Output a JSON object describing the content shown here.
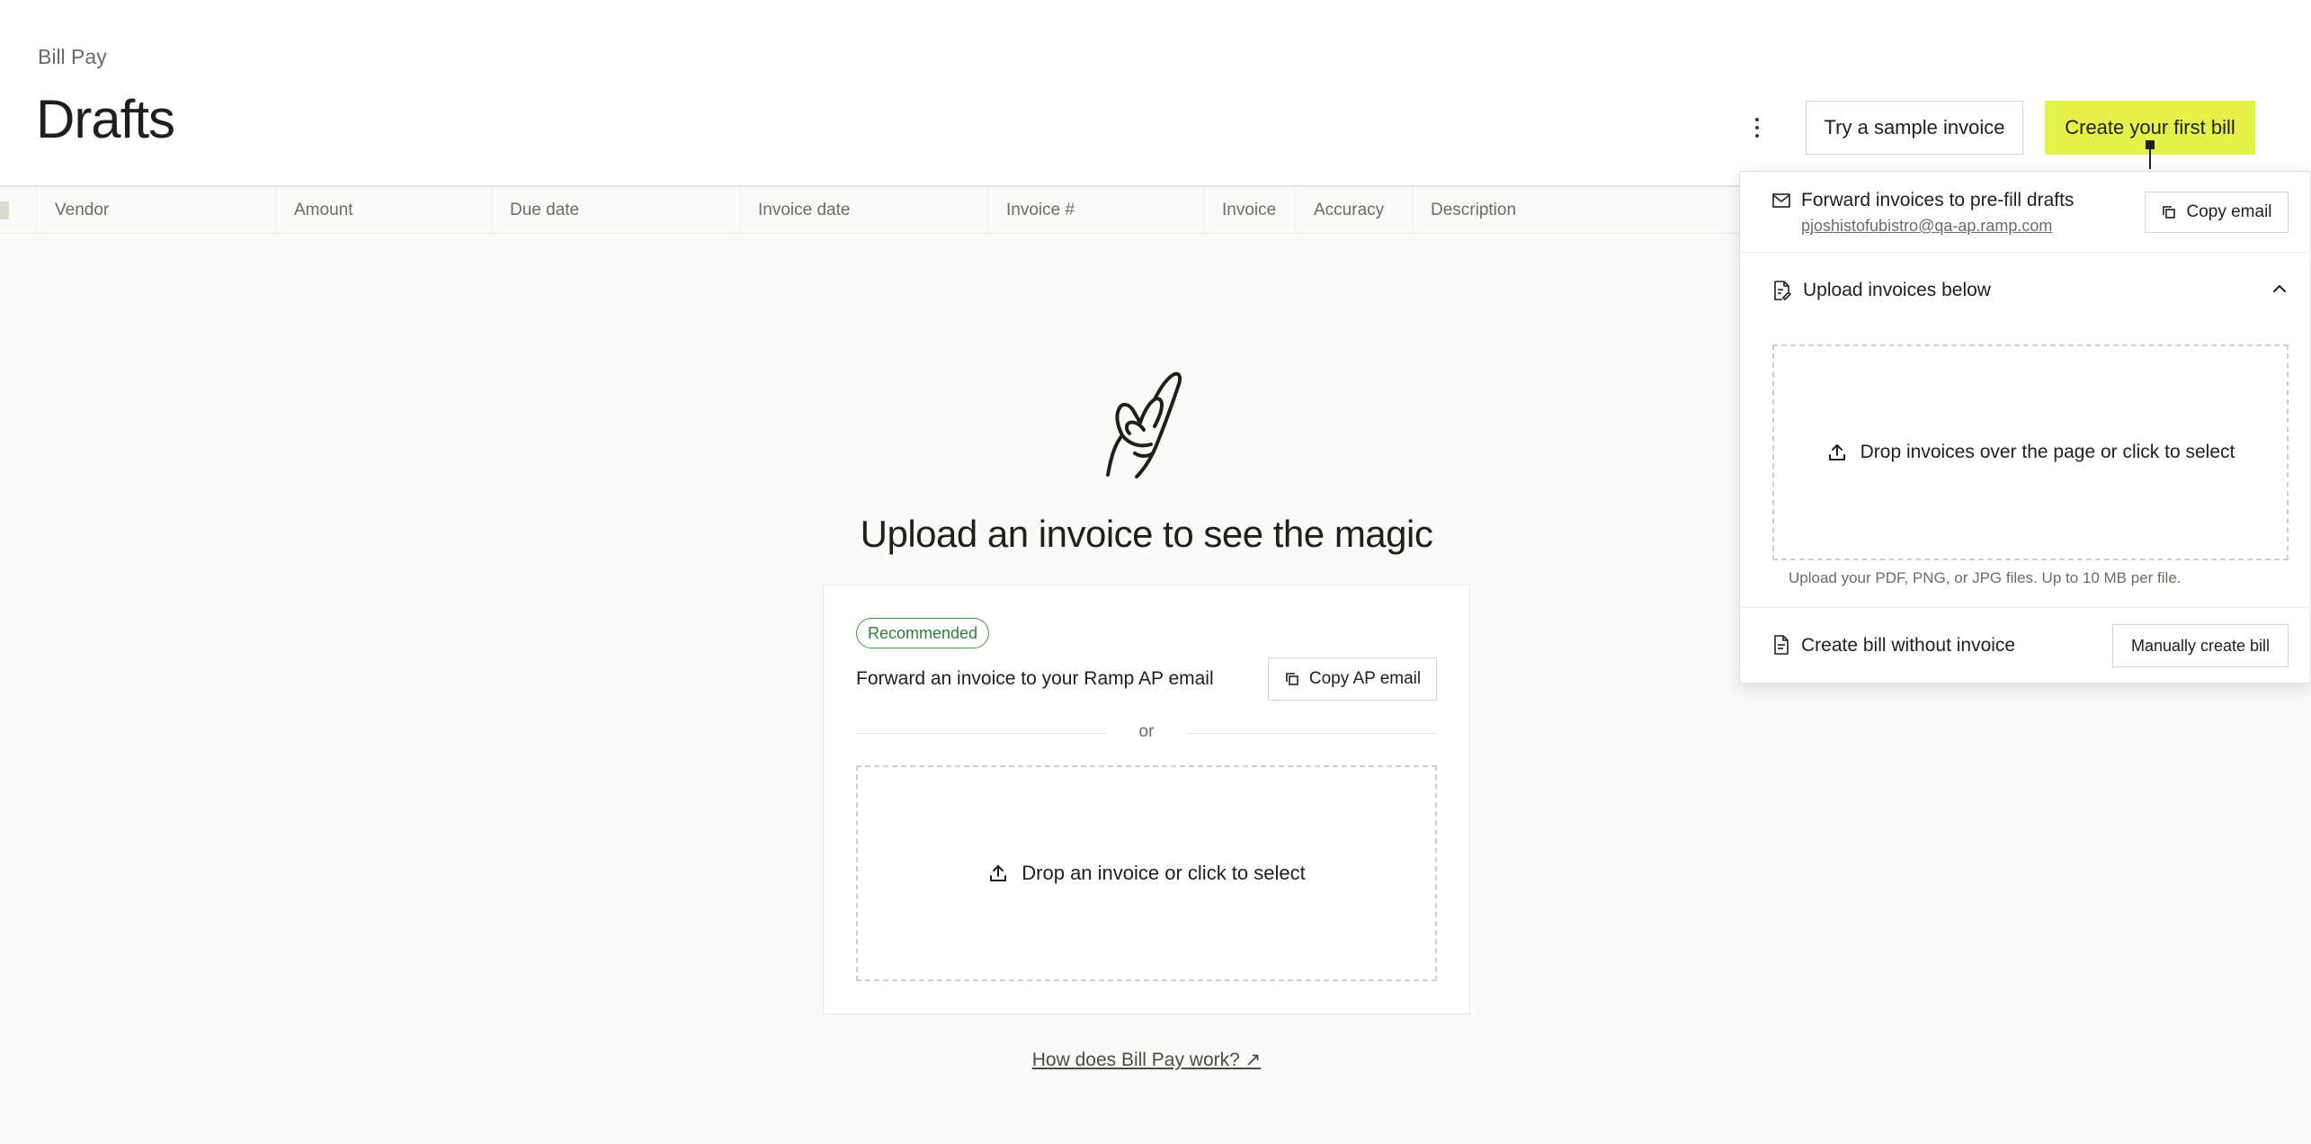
{
  "header": {
    "breadcrumb": "Bill Pay",
    "title": "Drafts",
    "more_icon": "vertical-ellipsis-icon",
    "sample_button": "Try a sample invoice",
    "create_button": "Create your first bill",
    "accent_color": "#e4f24a"
  },
  "table": {
    "columns": [
      "Vendor",
      "Amount",
      "Due date",
      "Invoice date",
      "Invoice #",
      "Invoice",
      "Accuracy",
      "Description"
    ]
  },
  "empty_state": {
    "illustration": "hand-snap-icon",
    "title": "Upload an invoice to see the magic",
    "badge": "Recommended",
    "badge_color": "#3d9a4a",
    "forward_text": "Forward an invoice to your Ramp AP email",
    "copy_ap_button": "Copy AP email",
    "or_text": "or",
    "dropzone_text": "Drop an invoice or click to select",
    "help_link": "How does Bill Pay work? ↗"
  },
  "panel": {
    "forward_title": "Forward invoices to pre-fill drafts",
    "email": "pjoshistofubistro@qa-ap.ramp.com",
    "copy_email_button": "Copy email",
    "upload_title": "Upload invoices below",
    "dropzone_text": "Drop invoices over the page or click to select",
    "hint": "Upload your PDF, PNG, or JPG files. Up to 10 MB per file.",
    "create_without_title": "Create bill without invoice",
    "manual_button": "Manually create bill"
  }
}
